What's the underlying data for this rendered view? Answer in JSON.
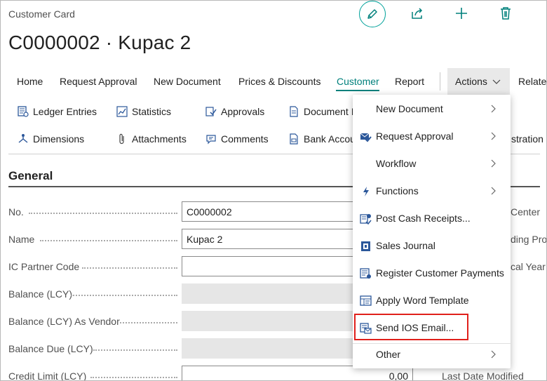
{
  "page": {
    "caption": "Customer Card",
    "record_title": "C0000002 · Kupac 2"
  },
  "toolbar": {
    "icons": [
      "pencil-icon",
      "share-icon",
      "plus-icon",
      "trash-icon"
    ]
  },
  "action_bar": {
    "items": [
      "Home",
      "Request Approval",
      "New Document",
      "Prices & Discounts",
      "Customer",
      "Report"
    ],
    "active": "Customer",
    "actions_label": "Actions",
    "related_label": "Related"
  },
  "promoted_actions": {
    "row1": [
      {
        "label": "Ledger Entries",
        "icon": "ledger-icon"
      },
      {
        "label": "Statistics",
        "icon": "statistics-icon"
      },
      {
        "label": "Approvals",
        "icon": "approvals-icon"
      },
      {
        "label": "Document I",
        "icon": "document-icon"
      }
    ],
    "row2": [
      {
        "label": "Dimensions",
        "icon": "dimensions-icon"
      },
      {
        "label": "Attachments",
        "icon": "paperclip-icon"
      },
      {
        "label": "Comments",
        "icon": "comment-icon"
      },
      {
        "label": "Bank Accou",
        "icon": "bank-icon"
      }
    ],
    "overflow_right": "stration"
  },
  "general": {
    "title": "General",
    "fields": [
      {
        "label": "No.",
        "value": "C0000002",
        "type": "input"
      },
      {
        "label": "Name",
        "value": "Kupac 2",
        "type": "input"
      },
      {
        "label": "IC Partner Code",
        "value": "",
        "type": "input"
      },
      {
        "label": "Balance (LCY)",
        "value": "",
        "type": "readonly"
      },
      {
        "label": "Balance (LCY) As Vendor",
        "value": "",
        "type": "readonly"
      },
      {
        "label": "Balance Due (LCY)",
        "value": "",
        "type": "readonly"
      },
      {
        "label": "Credit Limit (LCY)",
        "value": "0,00",
        "type": "input"
      }
    ],
    "right_labels": [
      "Center",
      "ding Pro",
      "cal Year",
      "Last Date Modified"
    ]
  },
  "actions_menu": {
    "items": [
      {
        "label": "New Document",
        "icon": "",
        "submenu": true
      },
      {
        "label": "Request Approval",
        "icon": "approve-icon",
        "submenu": true
      },
      {
        "label": "Workflow",
        "icon": "",
        "submenu": true
      },
      {
        "label": "Functions",
        "icon": "lightning-icon",
        "submenu": true
      },
      {
        "label": "Post Cash Receipts...",
        "icon": "cash-receipt-icon",
        "submenu": false
      },
      {
        "label": "Sales Journal",
        "icon": "journal-icon",
        "submenu": false
      },
      {
        "label": "Register Customer Payments",
        "icon": "register-payments-icon",
        "submenu": false
      },
      {
        "label": "Apply Word Template",
        "icon": "word-template-icon",
        "submenu": false
      },
      {
        "label": "Send IOS Email...",
        "icon": "send-email-icon",
        "submenu": false
      },
      {
        "label": "Other",
        "icon": "",
        "submenu": true
      }
    ],
    "highlighted": "Send IOS Email...",
    "highlight_color": "#e0201b"
  },
  "colors": {
    "accent": "#00807c",
    "edit_ring": "#00a19a",
    "highlight": "#e0201b"
  }
}
